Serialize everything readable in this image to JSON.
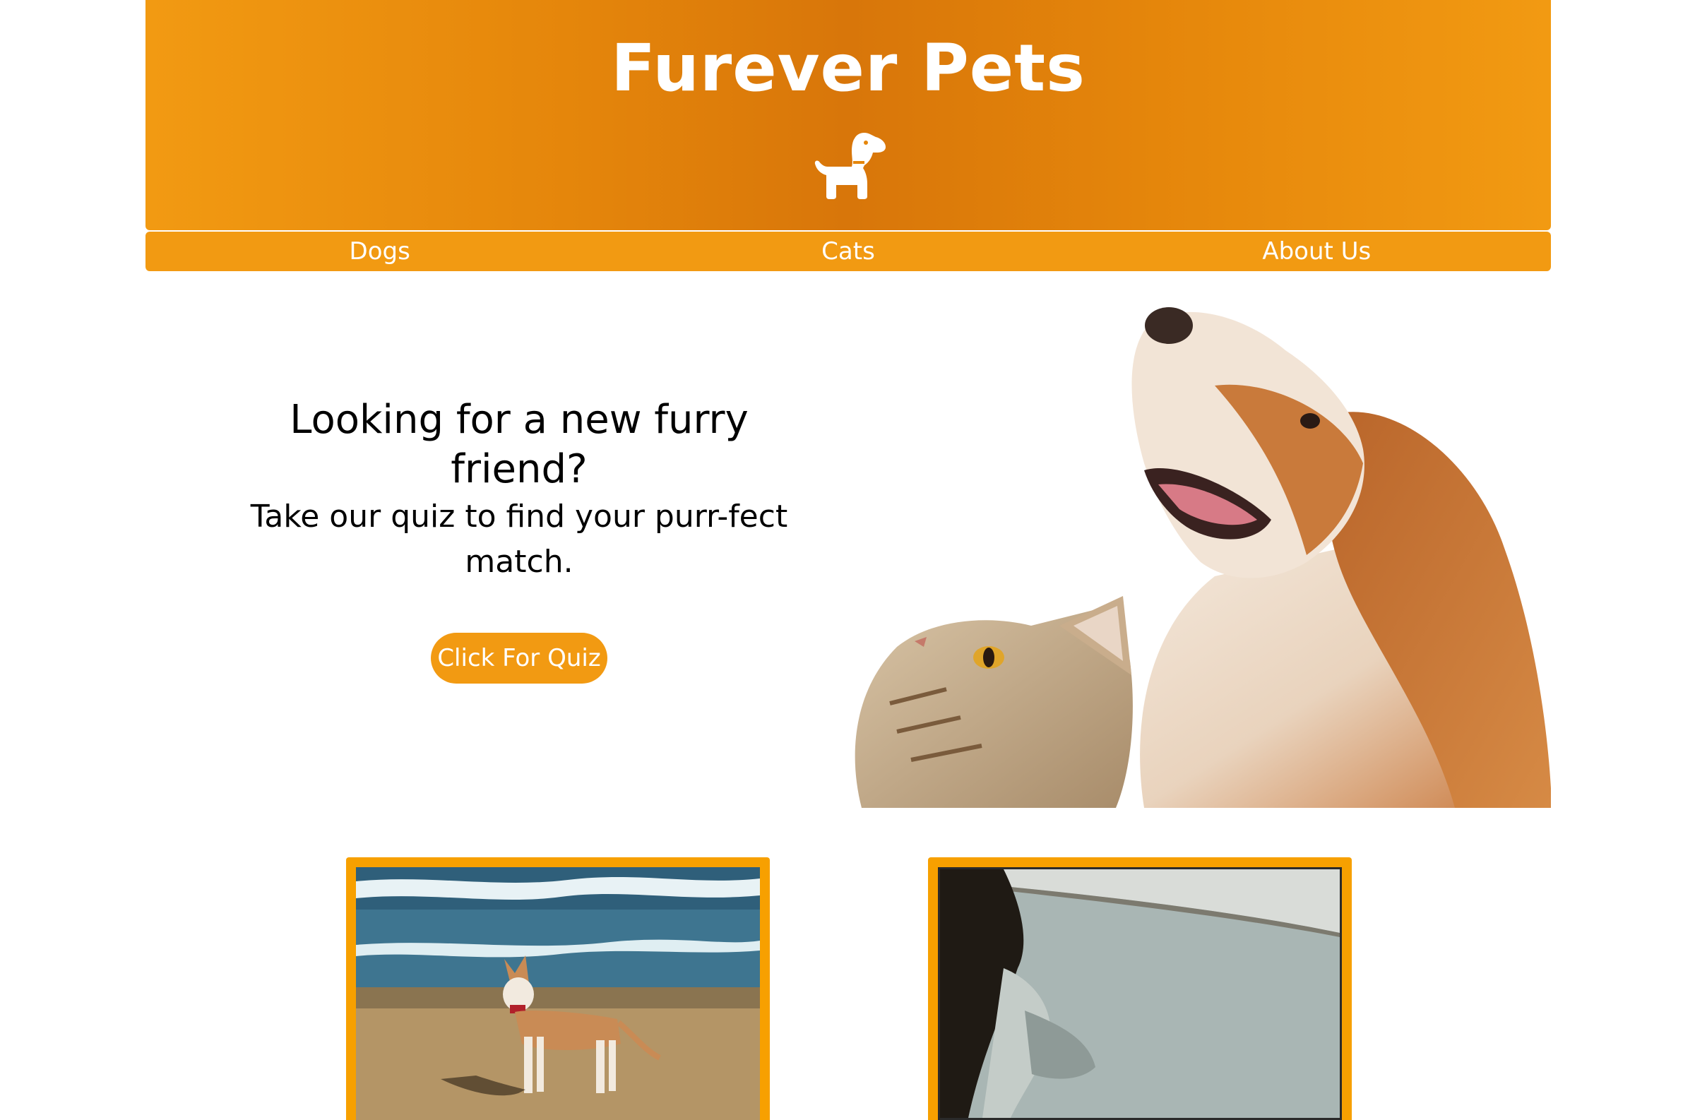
{
  "header": {
    "title": "Furever Pets",
    "logo_icon": "dog-icon"
  },
  "nav": {
    "items": [
      {
        "label": "Dogs"
      },
      {
        "label": "Cats"
      },
      {
        "label": "About Us"
      }
    ]
  },
  "hero": {
    "heading": "Looking for a new furry friend?",
    "subheading": "Take our quiz to find your purr-fect match.",
    "button_label": "Click For Quiz"
  },
  "colors": {
    "brand_orange": "#f29a12",
    "header_dark_orange": "#d8760a",
    "card_border": "#f7a000",
    "text": "#000000",
    "white": "#ffffff"
  }
}
